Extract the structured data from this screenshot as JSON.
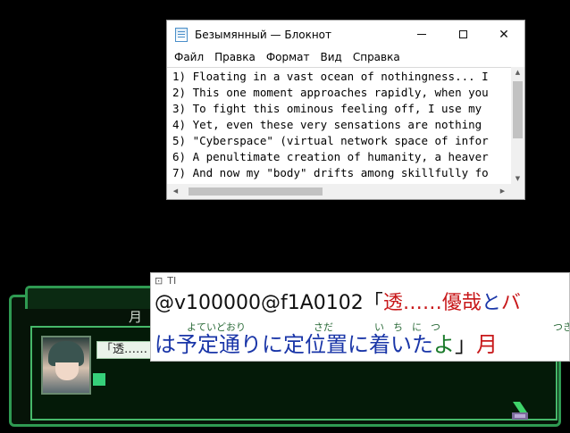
{
  "notepad": {
    "title": "Безымянный — Блокнот",
    "controls": {
      "close": "✕"
    },
    "menu": [
      "Файл",
      "Правка",
      "Формат",
      "Вид",
      "Справка"
    ],
    "lines": [
      "1) Floating in a vast ocean of nothingness... I",
      "2) This one moment approaches rapidly, when you",
      "3) To fight this ominous feeling off, I use my",
      "4) Yet, even these very sensations are nothing",
      "5) \"Cyberspace\" (virtual network space of infor",
      "6) A penultimate creation of humanity, a heaver",
      "7) And now my \"body\" drifts among skillfully fo"
    ],
    "scroll_arrows": {
      "up": "▲",
      "down": "▼",
      "left": "◀",
      "right": "▶"
    }
  },
  "overlay": {
    "toolbar": {
      "pin": "⊡",
      "text_tool": "TI"
    },
    "line1": {
      "code": "@v100000@f1A0102",
      "open_bracket": "「",
      "name": "透",
      "ellipsis": "……",
      "word": "優哉",
      "particle": "と",
      "tail": "バ"
    },
    "line2": {
      "p1": "は",
      "w1": "予定通り",
      "p2": "に",
      "w2": "定位置",
      "p3": "に",
      "w3": "着いた",
      "p4": "よ",
      "close_bracket": "」",
      "tail": "月"
    },
    "ruby": {
      "r1": "よていどおり",
      "r2": "さだ",
      "r3": "いちにつ",
      "r4": "つき"
    }
  },
  "game": {
    "tab_label": "月",
    "name_box": "「透……"
  },
  "colors": {
    "frame": "#2f9a52",
    "accent_red": "#c8181a",
    "accent_blue": "#1a36a8",
    "accent_green": "#1a7a2a"
  }
}
